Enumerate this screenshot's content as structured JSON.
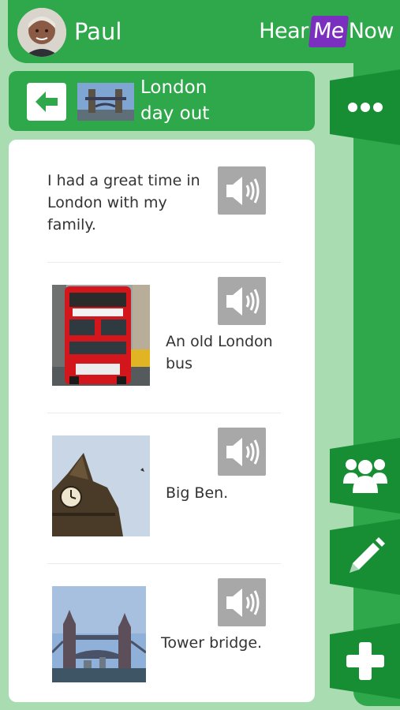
{
  "header": {
    "user_name": "Paul",
    "logo": {
      "part1": "Hear",
      "part2": "Me",
      "part3": "Now"
    }
  },
  "story": {
    "title_line1": "London",
    "title_line2": "day out"
  },
  "entries": [
    {
      "text": "I had a great time in London with my family."
    },
    {
      "text": "An old London bus",
      "photo": "red-bus-photo"
    },
    {
      "text": "Big Ben.",
      "photo": "big-ben-photo"
    },
    {
      "text": "Tower bridge.",
      "photo": "tower-bridge-photo"
    }
  ],
  "colors": {
    "background": "#a9dcb1",
    "primary": "#2ea84a",
    "dark_tab": "#178d34",
    "logo_accent": "#7b2fbe",
    "speaker_grey": "#a8a8a8"
  },
  "icons": {
    "back": "arrow-left-icon",
    "more": "more-dots-icon",
    "people": "people-group-icon",
    "edit": "pencil-icon",
    "add": "plus-icon",
    "speaker": "speaker-icon"
  }
}
